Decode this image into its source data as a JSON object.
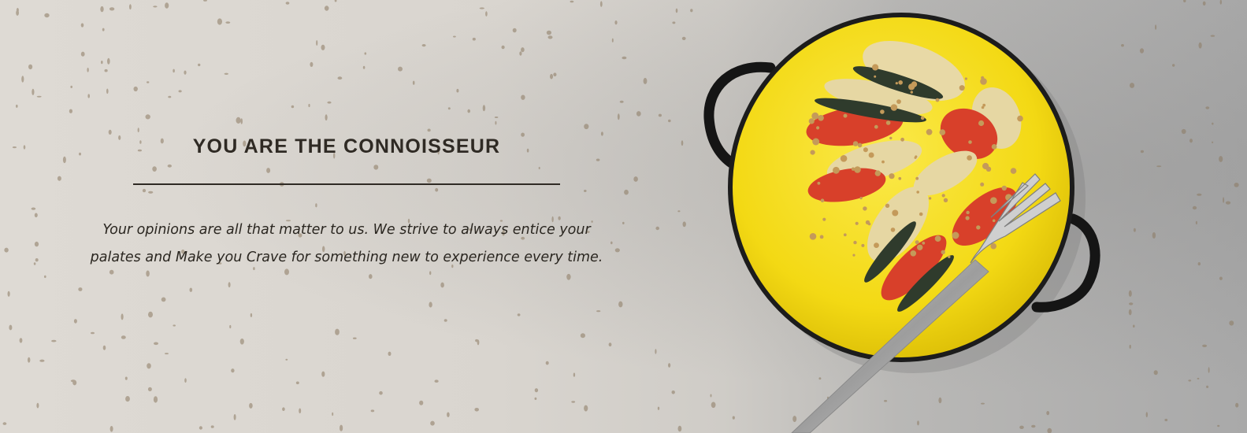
{
  "banner": {
    "heading": "YOU ARE THE CONNOISSEUR",
    "tagline_line1": "Your opinions are all that matter to us. We strive to always entice your",
    "tagline_line2": "palates and Make you Crave for something new to experience every time."
  },
  "colors": {
    "heading_text": "#2f2a24",
    "plate_yellow": "#f6dc1e",
    "plate_rim": "#1c1c1c",
    "tomato_red": "#d8402a",
    "zucchini_green": "#2f3b2c",
    "potato_cream": "#e6d7a3",
    "crumb_brown": "#c49a5a"
  },
  "photo": {
    "subject": "vegetable-tian-dish-with-fork"
  }
}
